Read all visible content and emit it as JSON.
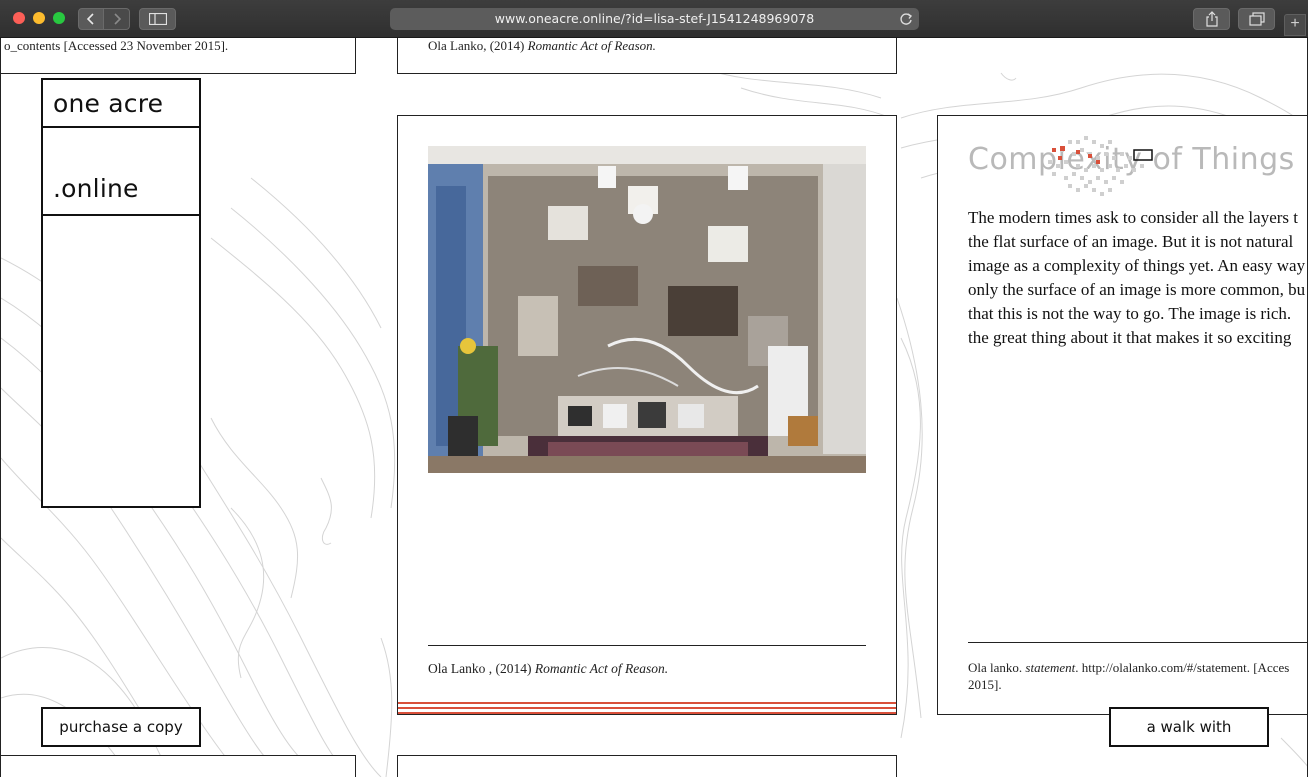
{
  "browser": {
    "url": "www.oneacre.online/?id=lisa-stef-J1541248969078",
    "new_tab_label": "+"
  },
  "refs": {
    "top_left": "o_contents [Accessed 23 November 2015].",
    "top_mid_author": "Ola Lanko, (2014) ",
    "top_mid_title": "Romantic Act of Reason."
  },
  "logo": {
    "line1": "one acre",
    "line2": ".online"
  },
  "buttons": {
    "purchase": "purchase a copy",
    "walk": "a walk with"
  },
  "image_card": {
    "caption_author": "Ola Lanko , (2014) ",
    "caption_title": "Romantic Act of Reason."
  },
  "text_card": {
    "title": "Complexity of Things",
    "body": "The modern times ask to consider all the layers t\nthe flat surface of an image. But it is not natural\nimage as a complexity of things yet. An easy way\nonly the surface of an image is more common, bu\nthat this is not the way to go. The image is rich.\nthe great thing about it that makes it so exciting",
    "ref_author": "Ola lanko. ",
    "ref_title": "statement",
    "ref_rest": ". http://olalanko.com/#/statement. [Acces",
    "ref_line2": "2015]."
  },
  "colors": {
    "accent_red": "#d9503a",
    "border": "#222222",
    "title_grey": "#b9b9b9"
  }
}
